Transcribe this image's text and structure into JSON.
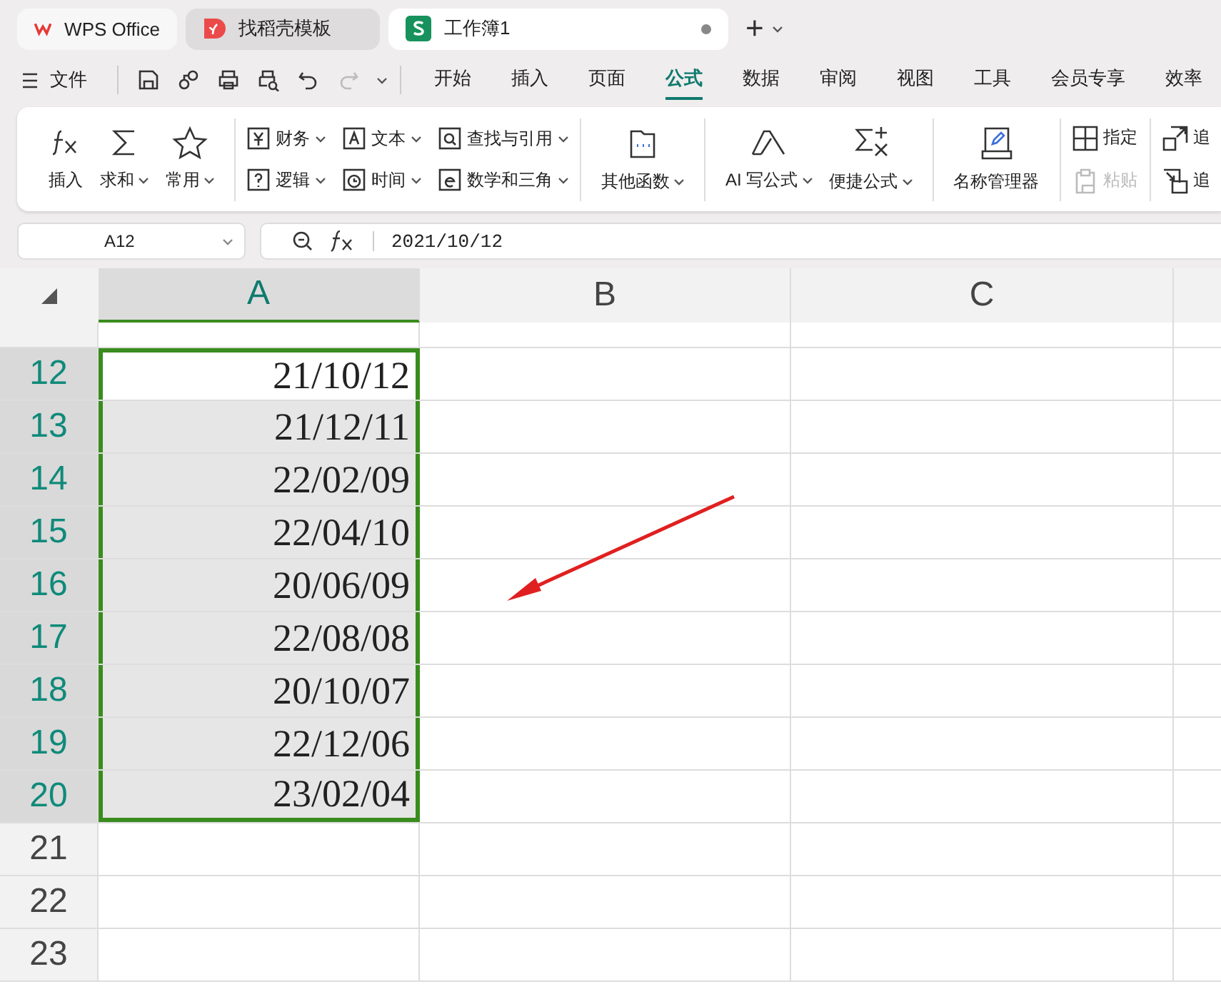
{
  "tabs": [
    {
      "label": "WPS Office",
      "kind": "wps",
      "selected": false
    },
    {
      "label": "找稻壳模板",
      "kind": "template",
      "selected": false
    },
    {
      "label": "工作簿1",
      "kind": "sheet",
      "selected": true
    }
  ],
  "new_tab": "+",
  "menu": {
    "file": "文件",
    "tabs": [
      {
        "label": "开始",
        "selected": false
      },
      {
        "label": "插入",
        "selected": false
      },
      {
        "label": "页面",
        "selected": false
      },
      {
        "label": "公式",
        "selected": true
      },
      {
        "label": "数据",
        "selected": false
      },
      {
        "label": "审阅",
        "selected": false
      },
      {
        "label": "视图",
        "selected": false
      },
      {
        "label": "工具",
        "selected": false
      },
      {
        "label": "会员专享",
        "selected": false
      },
      {
        "label": "效率",
        "selected": false
      }
    ]
  },
  "ribbon": {
    "groups": [
      {
        "kind": "large",
        "items": [
          {
            "label": "插入",
            "dropdown": false,
            "disabled": false
          },
          {
            "label": "求和",
            "dropdown": true,
            "disabled": false
          },
          {
            "label": "常用",
            "dropdown": true,
            "disabled": false
          }
        ]
      },
      {
        "kind": "small",
        "items": [
          {
            "label": "财务",
            "dropdown": true,
            "disabled": false
          },
          {
            "label": "逻辑",
            "dropdown": true,
            "disabled": false
          },
          {
            "label": "文本",
            "dropdown": true,
            "disabled": false
          },
          {
            "label": "时间",
            "dropdown": true,
            "disabled": false
          },
          {
            "label": "查找与引用",
            "dropdown": true,
            "disabled": false
          },
          {
            "label": "数学和三角",
            "dropdown": true,
            "disabled": false
          }
        ]
      },
      {
        "kind": "large",
        "items": [
          {
            "label": "其他函数",
            "dropdown": true,
            "disabled": false
          }
        ]
      },
      {
        "kind": "large",
        "items": [
          {
            "label": "AI 写公式",
            "dropdown": true,
            "disabled": false
          },
          {
            "label": "便捷公式",
            "dropdown": true,
            "disabled": false
          }
        ]
      },
      {
        "kind": "large",
        "items": [
          {
            "label": "名称管理器",
            "dropdown": false,
            "disabled": false
          }
        ]
      },
      {
        "kind": "small",
        "items": [
          {
            "label": "指定",
            "dropdown": false,
            "disabled": false
          },
          {
            "label": "粘贴",
            "dropdown": false,
            "disabled": true
          }
        ]
      },
      {
        "kind": "small",
        "items": [
          {
            "label": "追",
            "dropdown": false,
            "disabled": false
          },
          {
            "label": "追",
            "dropdown": false,
            "disabled": false
          }
        ]
      }
    ]
  },
  "name_box": "A12",
  "formula": "2021/10/12",
  "columns": [
    {
      "label": "A",
      "selected": true
    },
    {
      "label": "B",
      "selected": false
    },
    {
      "label": "C",
      "selected": false
    }
  ],
  "rows": [
    {
      "number": "12",
      "value": "21/10/12",
      "selected": true,
      "active": true
    },
    {
      "number": "13",
      "value": "21/12/11",
      "selected": true,
      "active": false
    },
    {
      "number": "14",
      "value": "22/02/09",
      "selected": true,
      "active": false
    },
    {
      "number": "15",
      "value": "22/04/10",
      "selected": true,
      "active": false
    },
    {
      "number": "16",
      "value": "20/06/09",
      "selected": true,
      "active": false
    },
    {
      "number": "17",
      "value": "22/08/08",
      "selected": true,
      "active": false
    },
    {
      "number": "18",
      "value": "20/10/07",
      "selected": true,
      "active": false
    },
    {
      "number": "19",
      "value": "22/12/06",
      "selected": true,
      "active": false
    },
    {
      "number": "20",
      "value": "23/02/04",
      "selected": true,
      "active": false
    },
    {
      "number": "21",
      "value": null,
      "selected": false
    },
    {
      "number": "22",
      "value": null,
      "selected": false
    },
    {
      "number": "23",
      "value": null,
      "selected": false
    }
  ]
}
